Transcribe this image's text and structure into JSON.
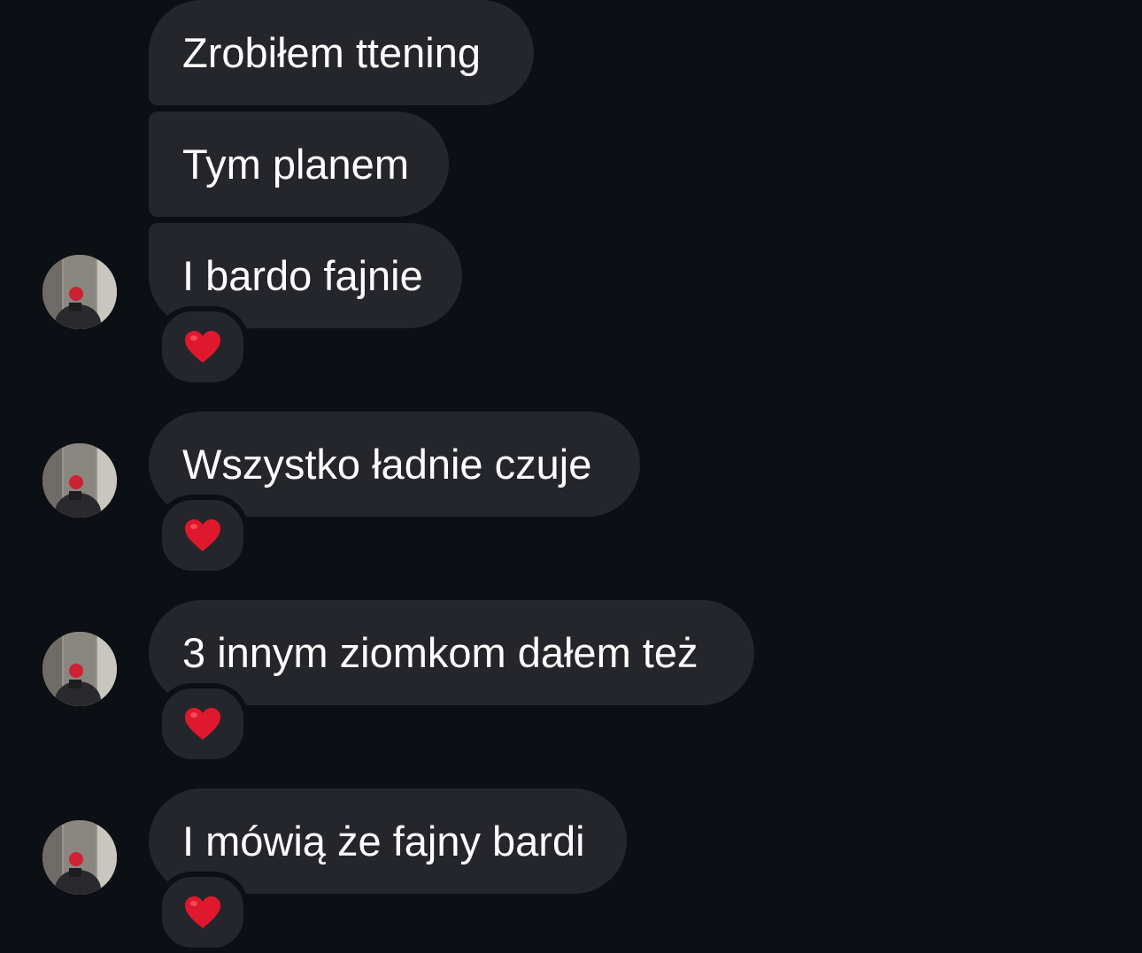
{
  "messages": [
    {
      "text": "Zrobiłem ttening",
      "reaction": null,
      "avatar": false
    },
    {
      "text": "Tym planem",
      "reaction": null,
      "avatar": false
    },
    {
      "text": "I bardo fajnie",
      "reaction": "heart",
      "avatar": true
    },
    {
      "text": "Wszystko ładnie czuje",
      "reaction": "heart",
      "avatar": true
    },
    {
      "text": "3 innym ziomkom dałem też",
      "reaction": "heart",
      "avatar": true
    },
    {
      "text": "I mówią że fajny bardi",
      "reaction": "heart",
      "avatar": true
    }
  ],
  "colors": {
    "background": "#0c0f14",
    "bubble": "#25262b",
    "text": "#ffffff",
    "heart": "#e0182e"
  },
  "icons": {
    "reaction": "red-heart-icon",
    "avatar": "profile-photo-avatar"
  }
}
